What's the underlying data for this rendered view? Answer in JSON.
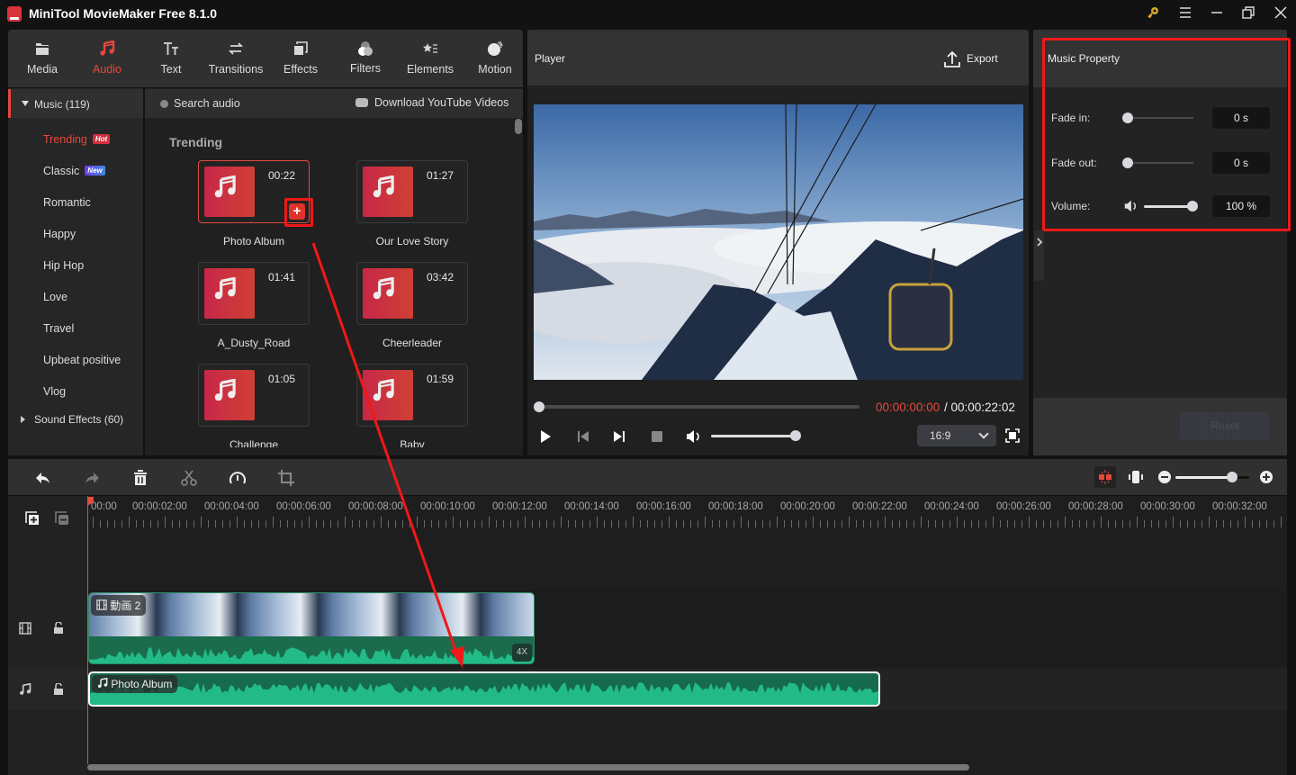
{
  "window": {
    "title": "MiniTool MovieMaker Free 8.1.0",
    "controls": [
      "key-icon",
      "menu-icon",
      "minimize-icon",
      "maximize-icon",
      "close-icon"
    ]
  },
  "toolbar": {
    "items": [
      {
        "label": "Media",
        "icon": "folder-icon",
        "active": false
      },
      {
        "label": "Audio",
        "icon": "music-note-icon",
        "active": true
      },
      {
        "label": "Text",
        "icon": "text-icon",
        "active": false
      },
      {
        "label": "Transitions",
        "icon": "swap-arrows-icon",
        "active": false
      },
      {
        "label": "Effects",
        "icon": "layers-icon",
        "active": false
      },
      {
        "label": "Filters",
        "icon": "filters-icon",
        "active": false
      },
      {
        "label": "Elements",
        "icon": "star-list-icon",
        "active": false
      },
      {
        "label": "Motion",
        "icon": "motion-ball-icon",
        "active": false
      }
    ]
  },
  "sidebar": {
    "music_header": "Music (119)",
    "categories": [
      {
        "label": "Trending",
        "badge": "Hot",
        "active": true
      },
      {
        "label": "Classic",
        "badge": "New",
        "active": false
      },
      {
        "label": "Romantic"
      },
      {
        "label": "Happy"
      },
      {
        "label": "Hip Hop"
      },
      {
        "label": "Love"
      },
      {
        "label": "Travel"
      },
      {
        "label": "Upbeat positive"
      },
      {
        "label": "Vlog"
      }
    ],
    "sound_effects": "Sound Effects (60)"
  },
  "audio_panel": {
    "search_placeholder": "Search audio",
    "download_label": "Download YouTube Videos",
    "section_title": "Trending",
    "tracks": [
      {
        "name": "Photo Album",
        "duration": "00:22",
        "selected": true
      },
      {
        "name": "Our Love Story",
        "duration": "01:27"
      },
      {
        "name": "A_Dusty_Road",
        "duration": "01:41"
      },
      {
        "name": "Cheerleader",
        "duration": "03:42"
      },
      {
        "name": "Challenge",
        "duration": "01:05"
      },
      {
        "name": "Baby",
        "duration": "01:59"
      }
    ],
    "add_button": "+"
  },
  "player": {
    "title": "Player",
    "export_label": "Export",
    "current_time": "00:00:00:00",
    "separator": " / ",
    "total_time": "00:00:22:02",
    "progress": 0,
    "volume": 1.0,
    "aspect_ratio": "16:9"
  },
  "music_property": {
    "title": "Music Property",
    "fade_in_label": "Fade in:",
    "fade_in_value": "0 s",
    "fade_in": 0,
    "fade_out_label": "Fade out:",
    "fade_out_value": "0 s",
    "fade_out": 0,
    "volume_label": "Volume:",
    "volume_value": "100 %",
    "volume": 1.0,
    "reset_label": "Reset"
  },
  "timeline": {
    "ruler_labels": [
      "00:00",
      "00:00:02:00",
      "00:00:04:00",
      "00:00:06:00",
      "00:00:08:00",
      "00:00:10:00",
      "00:00:12:00",
      "00:00:14:00",
      "00:00:16:00",
      "00:00:18:00",
      "00:00:20:00",
      "00:00:22:00",
      "00:00:24:00",
      "00:00:26:00",
      "00:00:28:00",
      "00:00:30:00",
      "00:00:32:00"
    ],
    "video_clip_label": "動画 2",
    "video_clip_speed": "4X",
    "audio_clip_label": "Photo Album",
    "zoom_level": 0.77
  },
  "colors": {
    "accent": "#e8473d",
    "highlight": "#f01818",
    "waveform": "#22bb88"
  }
}
